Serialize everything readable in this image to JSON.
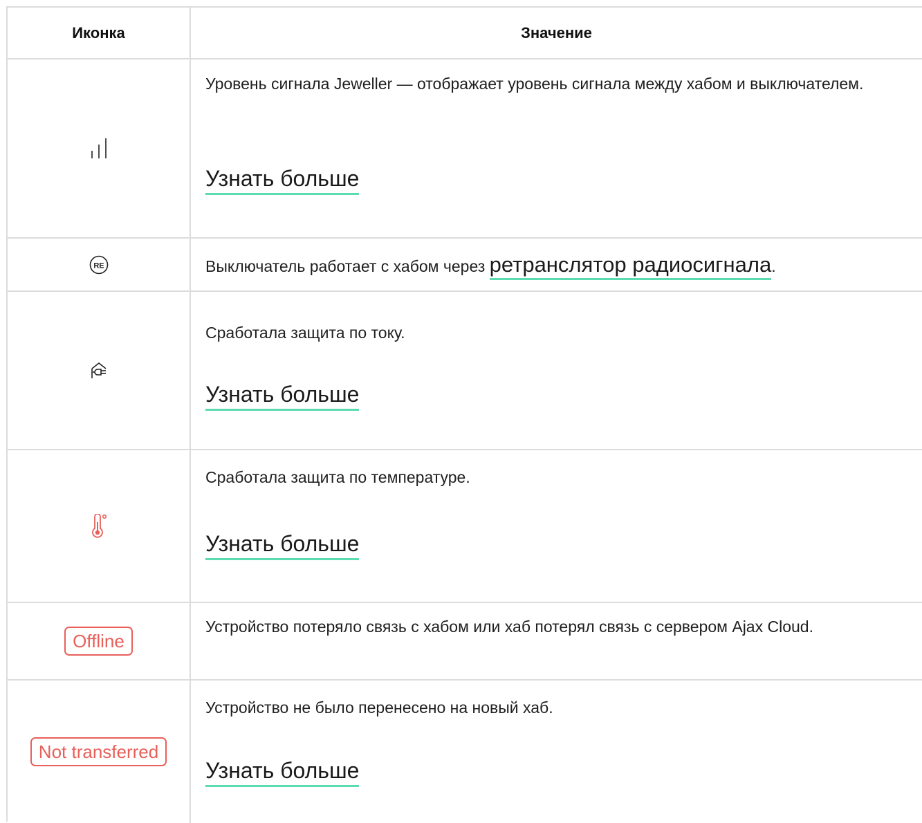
{
  "header": {
    "icon_col": "Иконка",
    "meaning_col": "Значение"
  },
  "rows": [
    {
      "icon": "signal-strength-icon",
      "text": "Уровень сигнала Jeweller — отображает уровень сигнала между хабом и выключателем.",
      "link": "Узнать больше"
    },
    {
      "icon": "range-extender-icon",
      "text_before": "Выключатель работает с хабом через ",
      "link_inline": "ретранслятор радиосигнала",
      "text_after": "."
    },
    {
      "icon": "current-protection-icon",
      "text": "Сработала защита по току.",
      "link": "Узнать больше"
    },
    {
      "icon": "temperature-protection-icon",
      "icon_color": "#e8605a",
      "text": "Сработала защита по температуре.",
      "link": "Узнать больше"
    },
    {
      "badge": "Offline",
      "badge_color": "#e8605a",
      "text": "Устройство потеряло связь с хабом или хаб потерял связь с сервером Ajax Cloud."
    },
    {
      "badge": "Not transferred",
      "badge_color": "#e8605a",
      "text": "Устройство не было перенесено на новый хаб.",
      "link": "Узнать больше"
    }
  ],
  "colors": {
    "border": "#dcdcdc",
    "link_underline": "#5cdbb0",
    "alert": "#e8605a"
  }
}
